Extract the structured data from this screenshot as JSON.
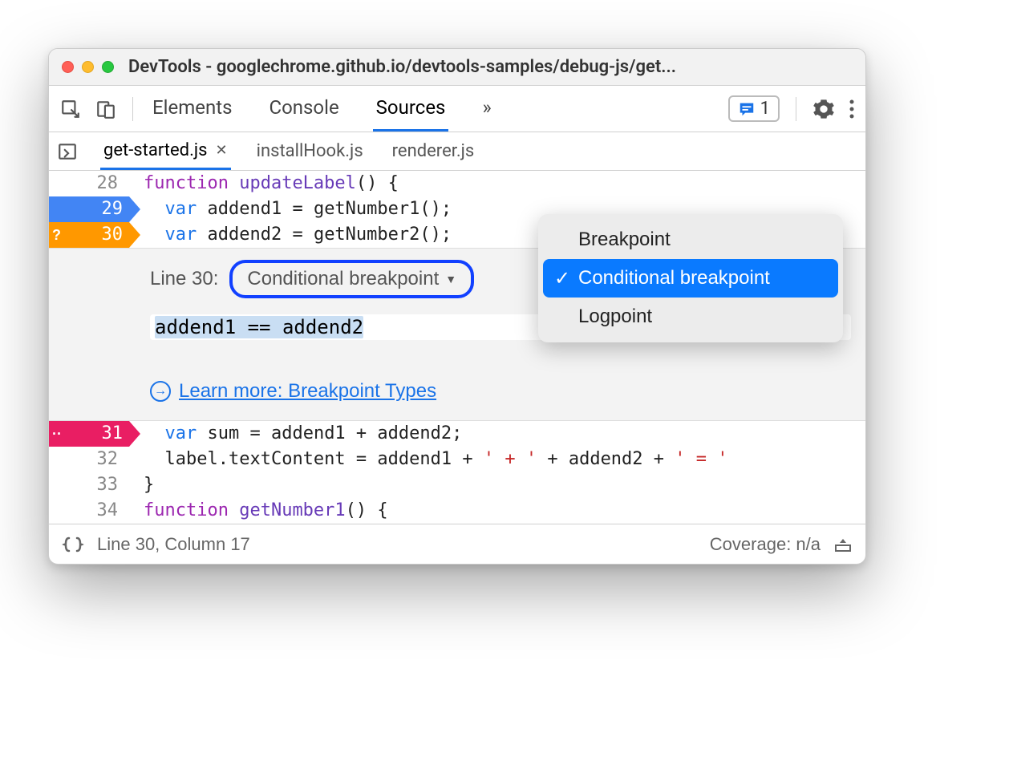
{
  "window": {
    "title": "DevTools - googlechrome.github.io/devtools-samples/debug-js/get..."
  },
  "panels": {
    "elements": "Elements",
    "console": "Console",
    "sources": "Sources",
    "more_glyph": "»"
  },
  "issues": {
    "count": "1"
  },
  "file_tabs": {
    "active": "get-started.js",
    "others": [
      "installHook.js",
      "renderer.js"
    ]
  },
  "code_lines": {
    "l28": {
      "num": "28",
      "pre": "",
      "kw": "function",
      "name": " updateLabel",
      "rest": "() {"
    },
    "l29": {
      "num": "29",
      "indent": "  ",
      "kw": "var",
      "rest": " addend1 = getNumber1();"
    },
    "l30": {
      "num": "30",
      "indent": "  ",
      "kw": "var",
      "rest": " addend2 = getNumber2();",
      "mark": "?"
    },
    "l31": {
      "num": "31",
      "indent": "  ",
      "kw": "var",
      "rest": " sum = addend1 + addend2;",
      "mark": "··"
    },
    "l32": {
      "num": "32",
      "indent": "  ",
      "text_a": "label.textContent = addend1 + ",
      "str1": "' + '",
      "text_b": " + addend2 + ",
      "str2": "' = '"
    },
    "l33": {
      "num": "33",
      "text": "}"
    },
    "l34": {
      "num": "34",
      "kw": "function",
      "name": " getNumber1",
      "rest": "() {"
    }
  },
  "bp_editor": {
    "line_label": "Line 30:",
    "type_label": "Conditional breakpoint",
    "expression": "addend1 == addend2",
    "learn_more": "Learn more: Breakpoint Types"
  },
  "bp_dropdown": {
    "items": [
      "Breakpoint",
      "Conditional breakpoint",
      "Logpoint"
    ],
    "selected_index": 1
  },
  "statusbar": {
    "position": "Line 30, Column 17",
    "coverage": "Coverage: n/a"
  }
}
